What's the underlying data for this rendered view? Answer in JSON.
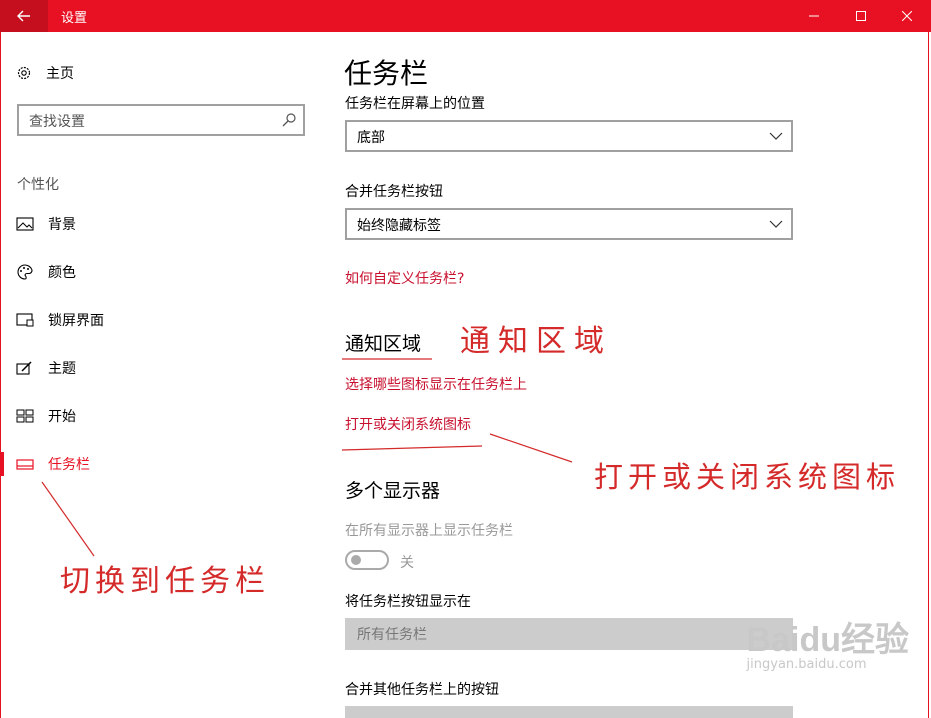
{
  "window": {
    "title": "设置"
  },
  "sidebar": {
    "home_label": "主页",
    "search_placeholder": "查找设置",
    "section": "个性化",
    "items": [
      {
        "label": "背景"
      },
      {
        "label": "颜色"
      },
      {
        "label": "锁屏界面"
      },
      {
        "label": "主题"
      },
      {
        "label": "开始"
      },
      {
        "label": "任务栏"
      }
    ],
    "active_index": 5
  },
  "main": {
    "title": "任务栏",
    "position_label": "任务栏在屏幕上的位置",
    "position_value": "底部",
    "combine_label": "合并任务栏按钮",
    "combine_value": "始终隐藏标签",
    "customize_link": "如何自定义任务栏?",
    "notify_heading": "通知区域",
    "notify_link1": "选择哪些图标显示在任务栏上",
    "notify_link2": "打开或关闭系统图标",
    "multi_heading": "多个显示器",
    "multi_show_label": "在所有显示器上显示任务栏",
    "toggle_state": "关",
    "show_buttons_label": "将任务栏按钮显示在",
    "show_buttons_value": "所有任务栏",
    "combine_other_label": "合并其他任务栏上的按钮"
  },
  "annotations": {
    "notify": "通知区域",
    "sysicons": "打开或关闭系统图标",
    "switch": "切换到任务栏"
  },
  "watermark": {
    "brand": "Baidu经验",
    "url": "jingyan.baidu.com"
  },
  "colors": {
    "accent": "#e81123",
    "link": "#c8102e",
    "annotation": "#d42a2a"
  }
}
